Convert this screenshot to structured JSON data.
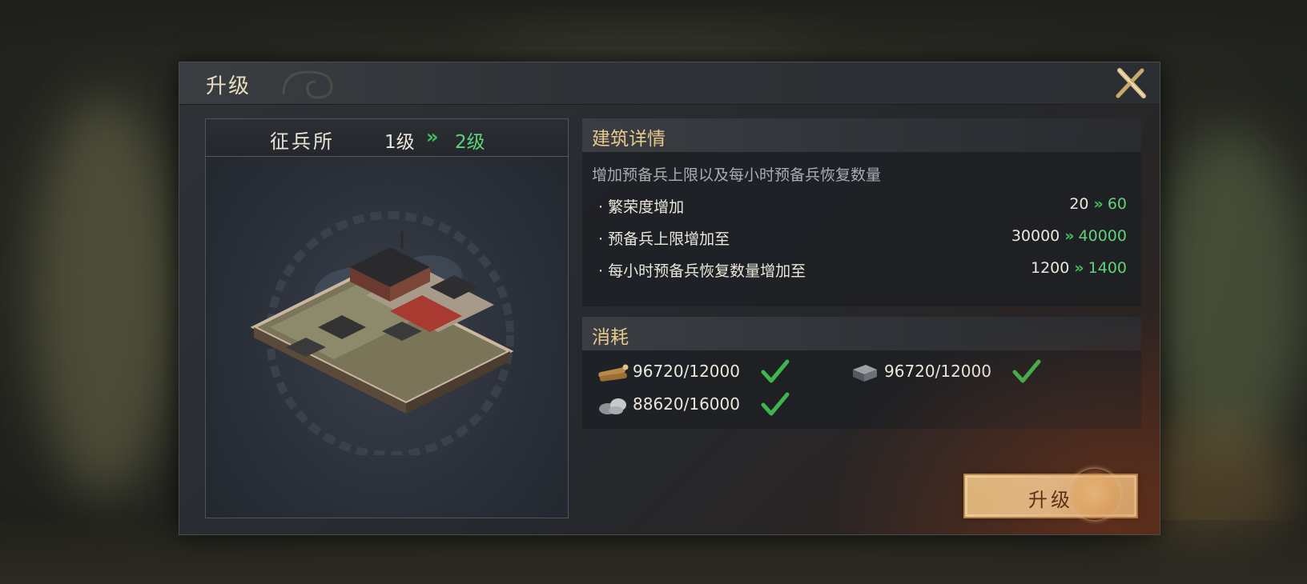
{
  "dialog": {
    "title": "升级",
    "close_icon": "close-icon"
  },
  "building": {
    "name": "征兵所",
    "level_from": "1级",
    "level_arrow": "»",
    "level_to": "2级"
  },
  "details": {
    "header": "建筑详情",
    "description": "增加预备兵上限以及每小时预备兵恢复数量",
    "stats": [
      {
        "label": "· 繁荣度增加",
        "from": "20",
        "to": "60"
      },
      {
        "label": "· 预备兵上限增加至",
        "from": "30000",
        "to": "40000"
      },
      {
        "label": "· 每小时预备兵恢复数量增加至",
        "from": "1200",
        "to": "1400"
      }
    ],
    "arrow": "»"
  },
  "cost": {
    "header": "消耗",
    "resources": [
      {
        "icon": "wood-icon",
        "amount": "96720/12000",
        "sufficient": true
      },
      {
        "icon": "iron-icon",
        "amount": "96720/12000",
        "sufficient": true
      },
      {
        "icon": "stone-icon",
        "amount": "88620/16000",
        "sufficient": true
      }
    ]
  },
  "actions": {
    "upgrade_label": "升级"
  },
  "colors": {
    "accent_gold": "#e7c98d",
    "green": "#5fd27a",
    "button_gold": "#f4dca6"
  }
}
